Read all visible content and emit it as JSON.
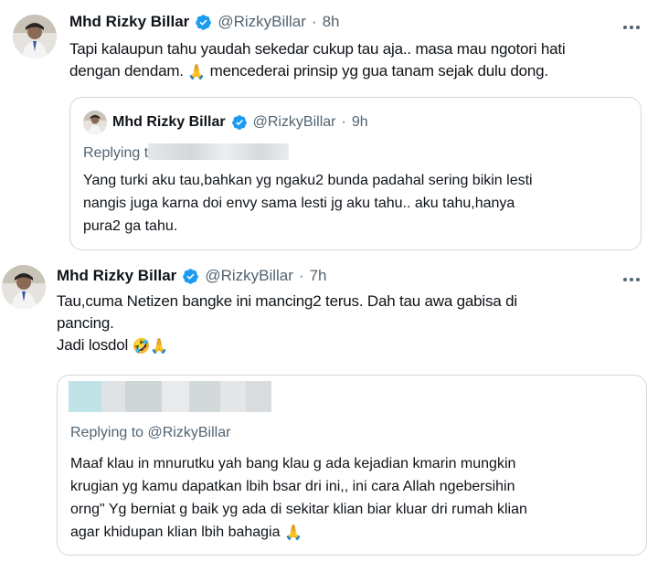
{
  "tweet1": {
    "author_name": "Mhd Rizky Billar",
    "handle": "@RizkyBillar",
    "dot": "·",
    "time": "8h",
    "text_lines": [
      "Tapi kalaupun tahu yaudah sekedar cukup tau aja.. masa mau ngotori hati",
      "dengan dendam.",
      "mencederai prinsip yg gua tanam sejak dulu dong."
    ],
    "emoji": "🙏",
    "quote": {
      "author_name": "Mhd Rizky Billar",
      "handle": "@RizkyBillar",
      "dot": "·",
      "time": "9h",
      "replying_prefix": "Replying t",
      "text_lines": [
        "Yang turki aku tau,bahkan yg ngaku2 bunda padahal sering bikin lesti",
        "nangis juga karna doi envy sama lesti jg aku tahu.. aku tahu,hanya",
        "pura2 ga tahu."
      ]
    }
  },
  "tweet2": {
    "author_name": "Mhd Rizky Billar",
    "handle": "@RizkyBillar",
    "dot": "·",
    "time": "7h",
    "text_lines": [
      "Tau,cuma Netizen bangke ini mancing2 terus. Dah tau awa gabisa di",
      "pancing.",
      "Jadi losdol"
    ],
    "emojis": [
      "🤣",
      "🙏"
    ],
    "quote": {
      "replying_prefix": "Replying to",
      "replying_handle": "@RizkyBillar",
      "text_lines": [
        "Maaf klau in mnurutku yah bang klau g ada kejadian kmarin mungkin",
        "krugian yg kamu dapatkan lbih bsar dri ini,, ini cara Allah ngebersihin",
        "orng\" Yg berniat g baik yg ada di sekitar klian biar kluar dri rumah klian",
        "agar khidupan klian lbih bahagia"
      ],
      "emoji": "🙏"
    }
  },
  "colors": {
    "text": "#0f1419",
    "secondary": "#536471",
    "border": "#cfd9de",
    "verified": "#1d9bf0"
  },
  "icons": {
    "verified": "verified-badge-icon",
    "more": "more-options-icon"
  }
}
